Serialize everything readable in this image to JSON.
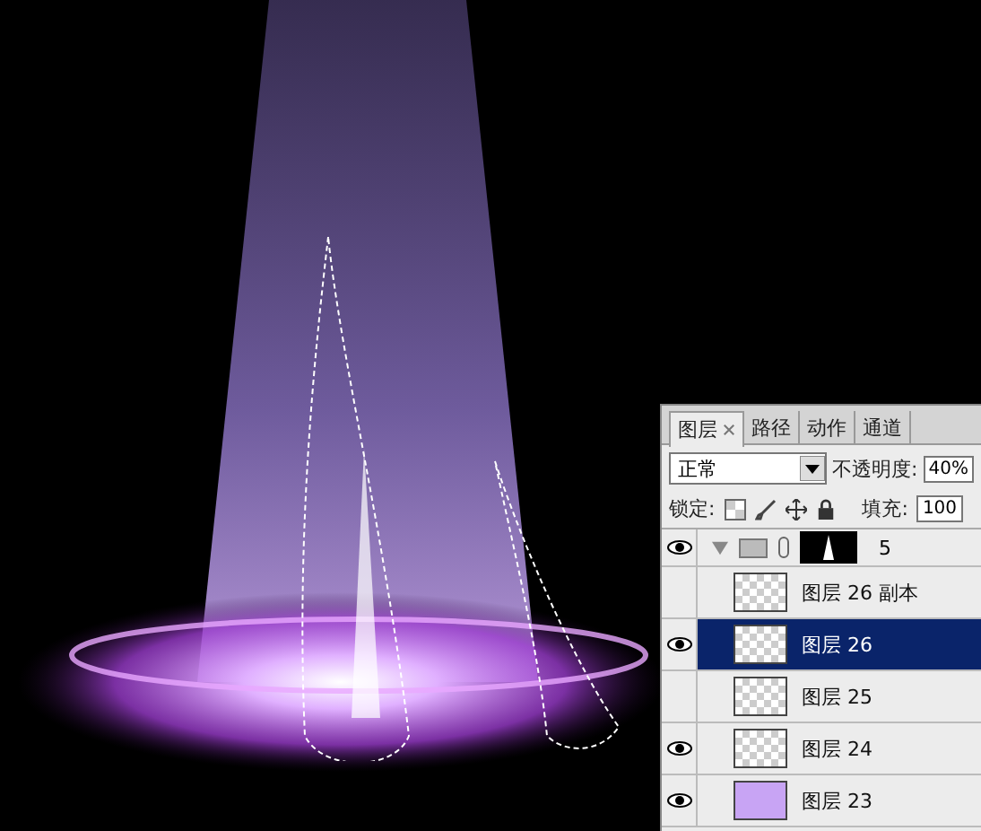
{
  "layers_panel": {
    "tabs": [
      {
        "label": "图层",
        "selected": true
      },
      {
        "label": "路径",
        "selected": false
      },
      {
        "label": "动作",
        "selected": false
      },
      {
        "label": "通道",
        "selected": false
      }
    ],
    "blend_mode": "正常",
    "opacity_label": "不透明度:",
    "opacity_value": "40%",
    "lock_label": "锁定:",
    "fill_label": "填充:",
    "fill_value": "100",
    "layers": [
      {
        "kind": "group",
        "name": "5",
        "visible": true,
        "expanded": true,
        "children": [
          {
            "kind": "transparent",
            "name": "图层 26 副本",
            "visible": false,
            "selected": false
          },
          {
            "kind": "transparent",
            "name": "图层 26",
            "visible": true,
            "selected": true
          },
          {
            "kind": "transparent",
            "name": "图层 25",
            "visible": false,
            "selected": false
          },
          {
            "kind": "transparent",
            "name": "图层 24",
            "visible": true,
            "selected": false
          },
          {
            "kind": "fill",
            "name": "图层 23",
            "visible": true,
            "selected": false
          }
        ]
      }
    ]
  }
}
